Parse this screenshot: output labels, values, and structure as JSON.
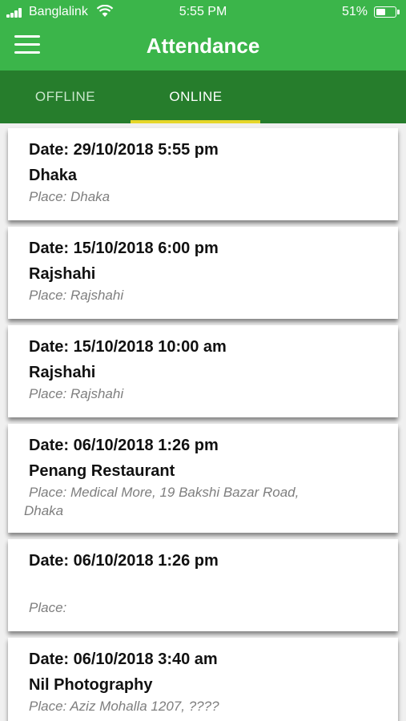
{
  "status_bar": {
    "carrier": "Banglalink",
    "time": "5:55 PM",
    "battery": "51%",
    "battery_level": 0.51
  },
  "header": {
    "title": "Attendance",
    "menu_icon": "hamburger-menu-icon"
  },
  "tabs": [
    {
      "label": "OFFLINE",
      "active": false
    },
    {
      "label": "ONLINE",
      "active": true
    }
  ],
  "colors": {
    "header_green": "#3bb54a",
    "tab_bar_green": "#267d2c",
    "tab_indicator": "#e6d62a"
  },
  "records": [
    {
      "date": "Date: 29/10/2018 5:55 pm",
      "name": "Dhaka",
      "place": "Place: Dhaka"
    },
    {
      "date": "Date: 15/10/2018 6:00 pm",
      "name": "Rajshahi",
      "place": "Place: Rajshahi"
    },
    {
      "date": "Date: 15/10/2018 10:00 am",
      "name": "Rajshahi",
      "place": "Place: Rajshahi"
    },
    {
      "date": "Date: 06/10/2018 1:26 pm",
      "name": "Penang Restaurant",
      "place": "Place: Medical More, 19 Bakshi Bazar Road,",
      "place_cont": "Dhaka"
    },
    {
      "date": "Date: 06/10/2018 1:26 pm",
      "name": "",
      "place": "Place:"
    },
    {
      "date": "Date: 06/10/2018 3:40 am",
      "name": "Nil Photography",
      "place": "Place: Aziz Mohalla 1207, ????"
    }
  ]
}
